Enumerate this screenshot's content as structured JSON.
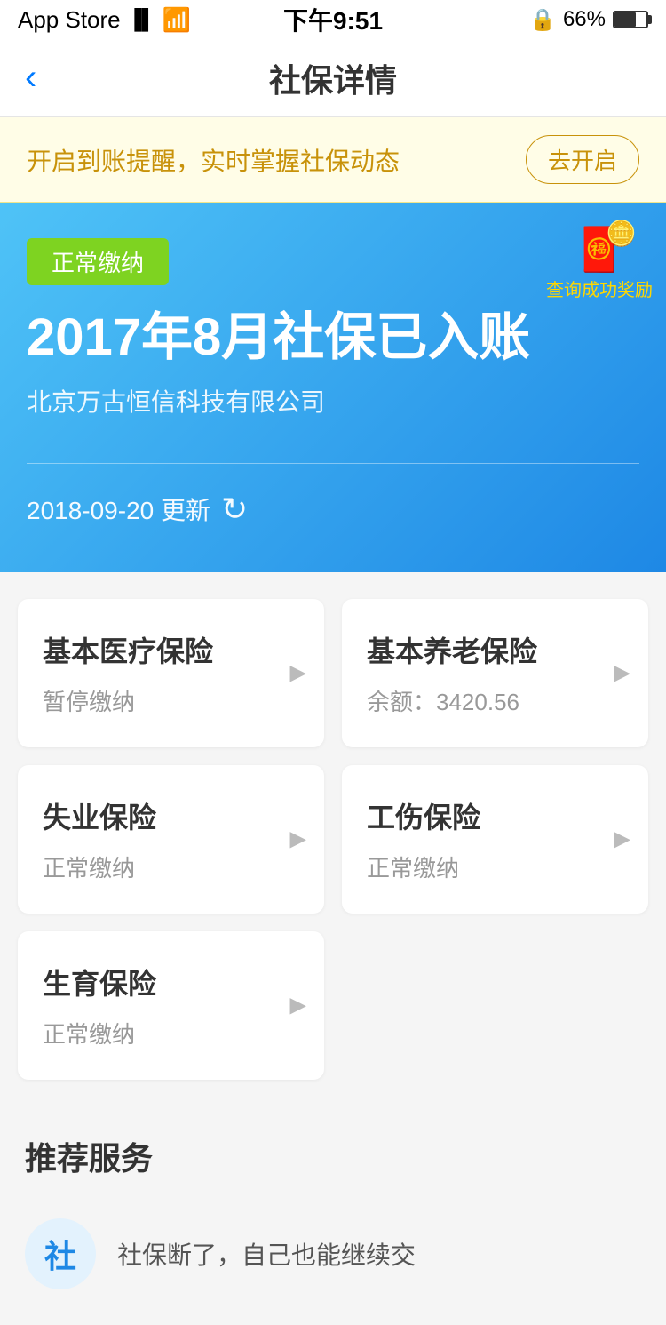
{
  "statusBar": {
    "appStore": "App Store",
    "time": "下午9:51",
    "battery": "66%"
  },
  "navBar": {
    "title": "社保详情",
    "backLabel": "‹"
  },
  "notificationBanner": {
    "text": "开启到账提醒，实时掌握社保动态",
    "buttonLabel": "去开启"
  },
  "hero": {
    "statusBadge": "正常缴纳",
    "title": "2017年8月社保已入账",
    "subtitle": "北京万古恒信科技有限公司",
    "updateDate": "2018-09-20 更新",
    "rewardText": "查询成功奖励"
  },
  "insuranceCards": [
    {
      "title": "基本医疗保险",
      "status": "暂停缴纳",
      "balance": null
    },
    {
      "title": "基本养老保险",
      "status": "余额：3420.56",
      "balance": "3420.56"
    },
    {
      "title": "失业保险",
      "status": "正常缴纳",
      "balance": null
    },
    {
      "title": "工伤保险",
      "status": "正常缴纳",
      "balance": null
    },
    {
      "title": "生育保险",
      "status": "正常缴纳",
      "balance": null
    }
  ],
  "recommendedSection": {
    "title": "推荐服务",
    "services": [
      {
        "icon": "社",
        "label": "社保断了，自己也能继续交"
      }
    ]
  }
}
